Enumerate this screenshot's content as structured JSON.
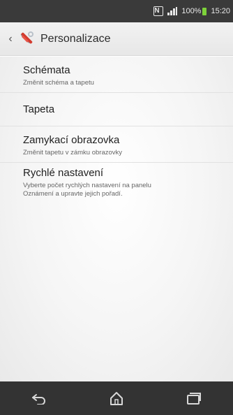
{
  "status_bar": {
    "signal_label": "▖▄█",
    "battery_percent": "100%",
    "time": "15:20",
    "nfc_label": "N"
  },
  "action_bar": {
    "back_glyph": "‹",
    "title": "Personalizace",
    "icon": "personalization-tools-icon"
  },
  "settings": [
    {
      "title": "Schémata",
      "subtitle": "Změnit schéma a tapetu"
    },
    {
      "title": "Tapeta",
      "subtitle": ""
    },
    {
      "title": "Zamykací obrazovka",
      "subtitle": "Změnit tapetu v zámku obrazovky"
    },
    {
      "title": "Rychlé nastavení",
      "subtitle_line1": "Vyberte počet rychlých nastavení na panelu",
      "subtitle_line2": "Oznámení a upravte jejich pořadí."
    }
  ],
  "navigation": {
    "back": "back-icon",
    "home": "home-icon",
    "recents": "recent-apps-icon"
  },
  "colors": {
    "status_bar": "#3a3a3a",
    "nav_bar": "#333333",
    "battery": "#7dd23a"
  }
}
